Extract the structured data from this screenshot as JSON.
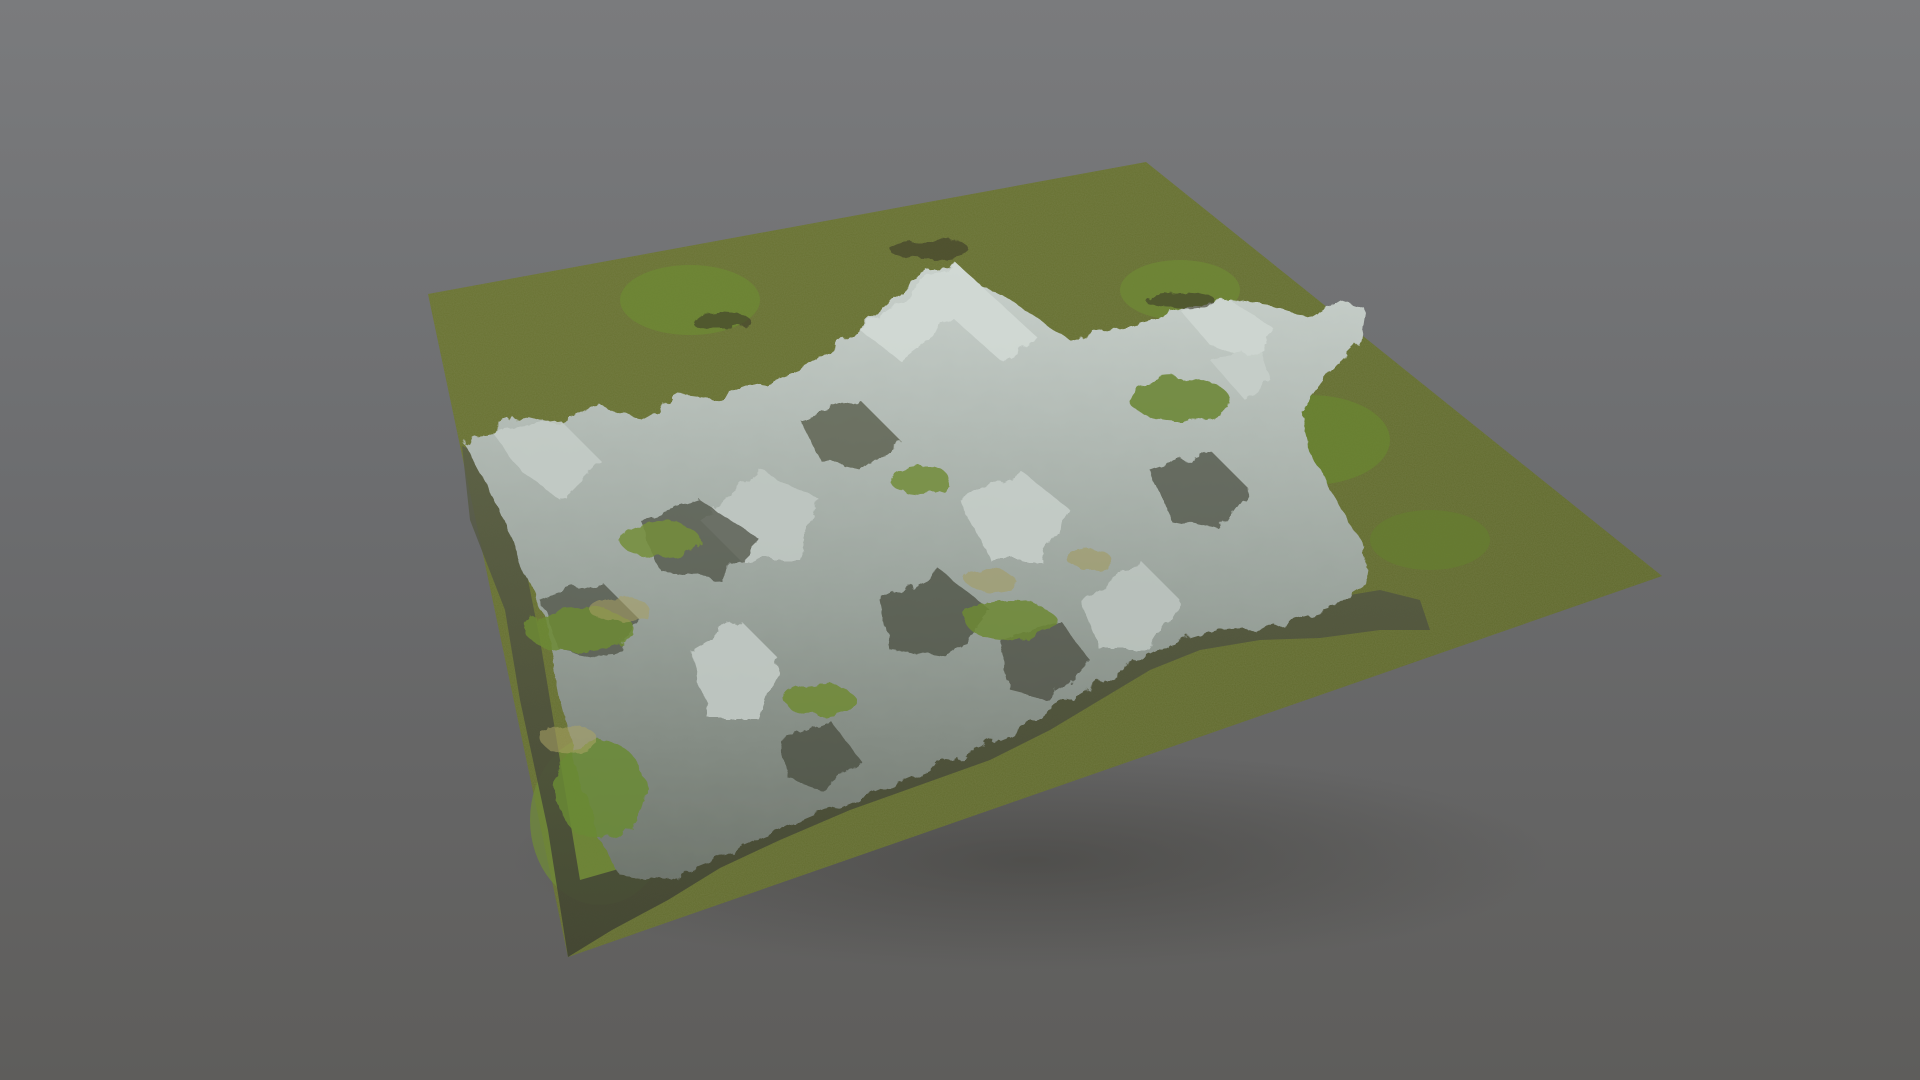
{
  "scene": {
    "subject": "terrain-mesh",
    "colors": {
      "background_top": "#7a7b7d",
      "background_bottom": "#5e5d5b",
      "grass": "#66702f",
      "grass_light": "#7d8a3c",
      "moss": "#5f7a2e",
      "rock": "#a9b3ad",
      "rock_light": "#c8d0cb",
      "rock_shadow": "#4a4d40",
      "soil_dark": "#3d3b2c",
      "dry_grass": "#a8a062",
      "shadow": "#4c4b47"
    }
  }
}
